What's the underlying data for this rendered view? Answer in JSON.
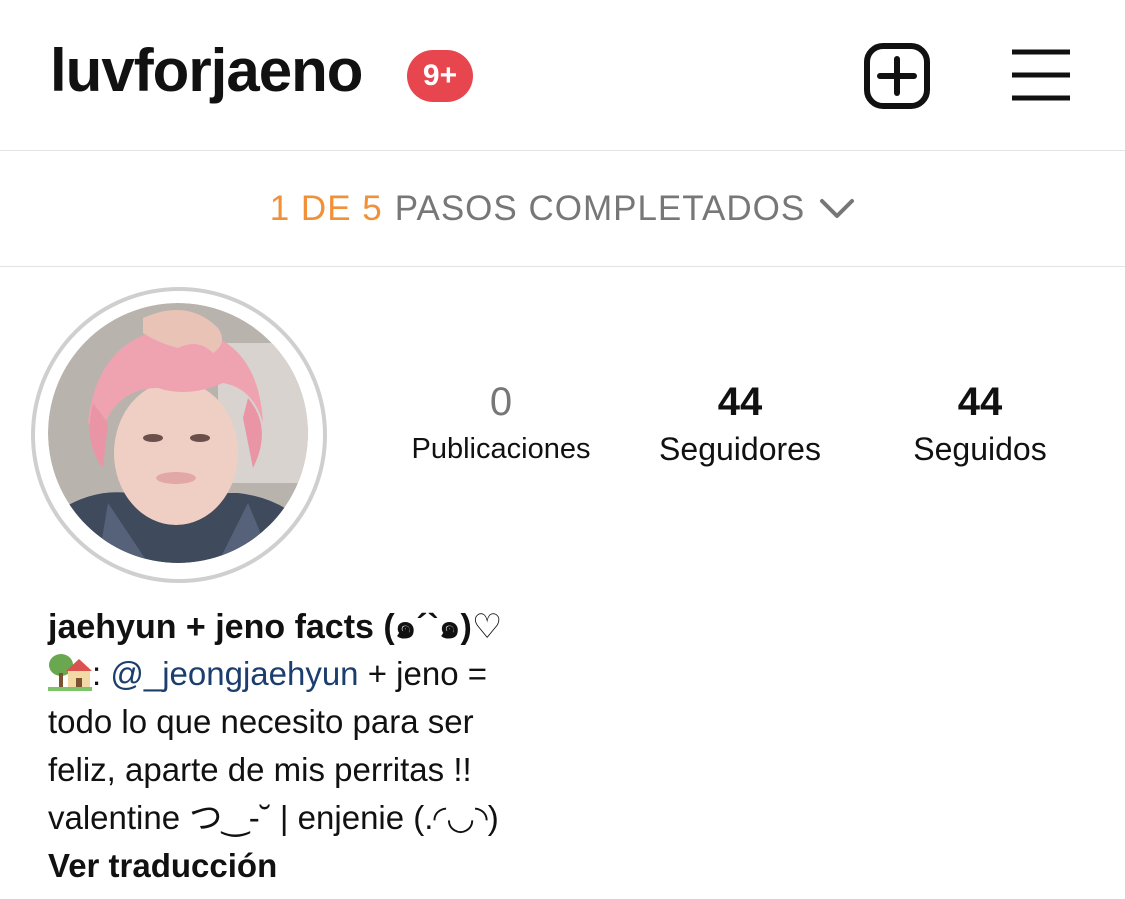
{
  "header": {
    "username": "luvforjaeno",
    "notification_badge": "9+",
    "new_post_icon": "plus-square-icon",
    "menu_icon": "hamburger-menu-icon"
  },
  "steps_banner": {
    "completed": "1 DE 5",
    "label": "PASOS COMPLETADOS",
    "chevron_icon": "chevron-down-icon"
  },
  "stats": [
    {
      "value": "0",
      "label": "Publicaciones"
    },
    {
      "value": "44",
      "label": "Seguidores"
    },
    {
      "value": "44",
      "label": "Seguidos"
    }
  ],
  "bio": {
    "name": "jaehyun + jeno facts (๑´`๑)♡",
    "line1_prefix": ": ",
    "line1_mention": "@_jeongjaehyun",
    "line1_suffix": " + jeno =",
    "line2": "todo lo que necesito para ser",
    "line3": "feliz, aparte de mis perritas !!",
    "line4": "valentine つ‿-˘ | enjenie (.◜◡◝)",
    "translate": "Ver traducción"
  },
  "colors": {
    "badge": "#e8464f",
    "steps_done": "#f0913a",
    "mention": "#1b3e6e"
  }
}
